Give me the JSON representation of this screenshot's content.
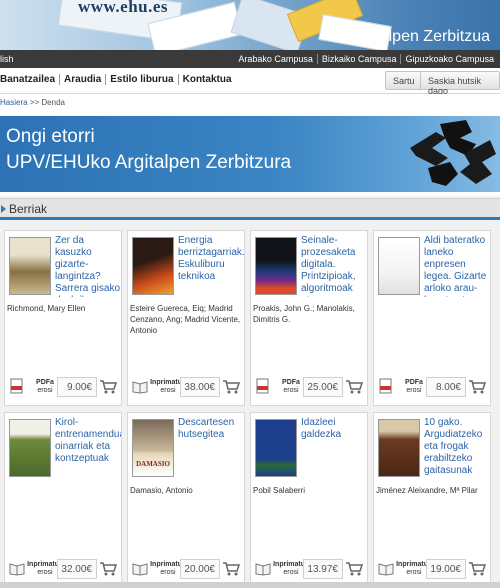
{
  "header": {
    "url": "www.ehu.es",
    "title": "Argitalpen Zerbitzua"
  },
  "topbar": {
    "language": "lish",
    "campuses": [
      "Arabako Campusa",
      "Bizkaiko Campusa",
      "Gipuzkoako Campusa"
    ]
  },
  "nav": {
    "items": [
      "Banatzailea",
      "Araudia",
      "Estilo liburua",
      "Kontaktua"
    ],
    "login_label": "Sartu",
    "cart_label": "Saskia hutsik dago"
  },
  "breadcrumb": {
    "home": "Hasiera",
    "separator": ">>",
    "current": "Denda"
  },
  "welcome": {
    "line1": "Ongi etorri",
    "line2": "UPV/EHUko Argitalpen Zerbitzura"
  },
  "section": {
    "title": "Berriak"
  },
  "products": [
    {
      "title": "Zer da kasuzko gizarte-langintza? Sarrera gisako deskribapen bat",
      "author": "Richmond, Mary Ellen",
      "format": "PDFa",
      "action": "erosi",
      "price": "9.00€",
      "cover_color": "#c9b890",
      "cover_icon": "cover-photo"
    },
    {
      "title": "Energia berriztagarriak. Eskuliburu teknikoa",
      "author": "Esteire Guereca, Eiq; Madrid Cenzano, Ang; Madrid Vicente, Antonio",
      "format": "Inprimatua",
      "action": "erosi",
      "price": "38.00€",
      "cover_color": "#2a1a14",
      "cover_icon": "cover-energy"
    },
    {
      "title": "Seinale-prozesaketa digitala. Printzipioak, algoritmoak eta aplikazioak",
      "author": "Proakis, John G.; Manolakis, Dimitris G.",
      "format": "PDFa",
      "action": "erosi",
      "price": "25.00€",
      "cover_color": "#101418",
      "cover_icon": "cover-signal"
    },
    {
      "title": "Aldi bateratko laneko enpresen legea. Gizarte arloko arau-hauste eta zehapenen",
      "author": "",
      "format": "PDFa",
      "action": "erosi",
      "price": "8.00€",
      "cover_color": "#f4f4f4",
      "cover_icon": "cover-plain"
    },
    {
      "title": "Kirol-entrenamenduare oinarriak eta kontzeptuak",
      "author": "",
      "format": "Inprimatua",
      "action": "erosi",
      "price": "32.00€",
      "cover_color": "#6f8a3c",
      "cover_icon": "cover-green"
    },
    {
      "title": "Descartesen hutsegitea",
      "author": "Damasio, Antonio",
      "format": "Inprimatua",
      "action": "erosi",
      "price": "20.00€",
      "cover_color": "#e6d8b8",
      "cover_icon": "cover-damasio",
      "cover_text": "DAMASIO"
    },
    {
      "title": "Idazleei galdezka",
      "author": "Pobil Salaberri",
      "format": "Inprimatua",
      "action": "erosi",
      "price": "13.97€",
      "cover_color": "#1e3f8c",
      "cover_icon": "cover-blue"
    },
    {
      "title": "10 gako. Argudiatzeko eta frogak erabiltzeko gaitasunak",
      "author": "Jiménez Aleixandre, Mª Pilar",
      "format": "Inprimatua",
      "action": "erosi",
      "price": "19.00€",
      "cover_color": "#6b3a22",
      "cover_icon": "cover-brown"
    }
  ],
  "colors": {
    "accent": "#2e78bd",
    "link": "#2b64a6",
    "topbar": "#3a3a3a"
  }
}
